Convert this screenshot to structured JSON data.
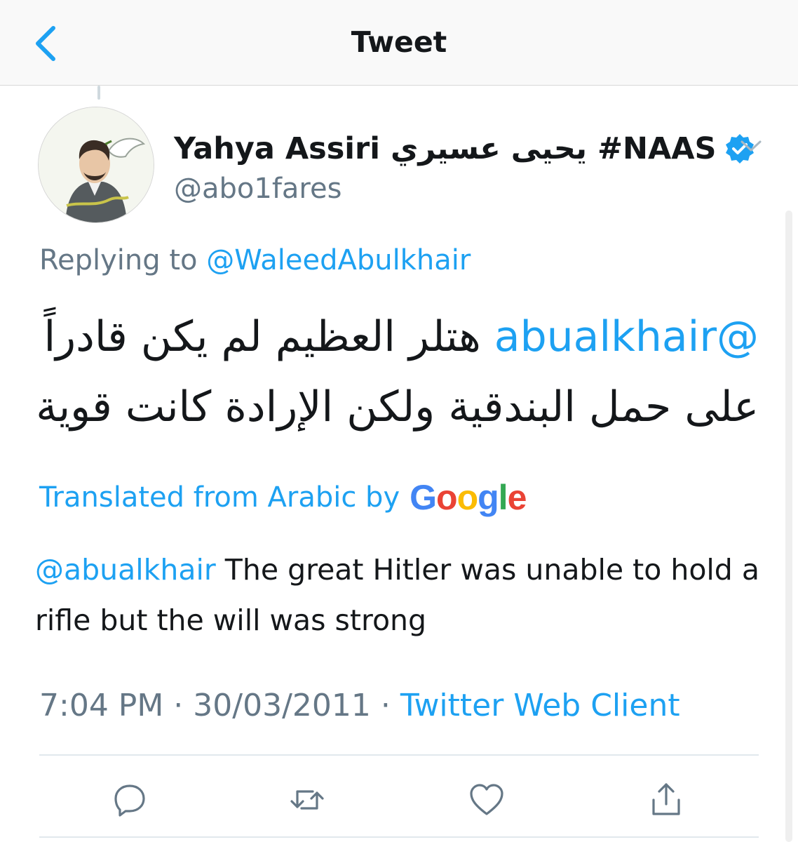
{
  "header": {
    "title": "Tweet",
    "back_icon": "chevron-left-icon"
  },
  "tweet": {
    "author_name": "Yahya Assiri يحيى عسيري #NAAS",
    "handle": "@abo1fares",
    "verified": true,
    "reply_prefix": "Replying to",
    "reply_to": "@WaleedAbulkhair",
    "text_mention": "@abualkhair",
    "text_arabic": "هتلر العظيم لم يكن قادراً على حمل البندقية ولكن الإرادة كانت قوية",
    "translated_label": "Translated from Arabic by",
    "google_letters": [
      "G",
      "o",
      "o",
      "g",
      "l",
      "e"
    ],
    "translation_mention": "@abualkhair",
    "translation_text": " The great Hitler was unable to hold a rifle but the will was strong",
    "time": "7:04 PM",
    "date": "30/03/2011",
    "separator": " · ",
    "client": "Twitter Web Client"
  },
  "actions": [
    {
      "name": "reply-icon"
    },
    {
      "name": "retweet-icon"
    },
    {
      "name": "like-icon"
    },
    {
      "name": "share-icon"
    }
  ],
  "colors": {
    "accent": "#1da1f2",
    "secondary_text": "#657786",
    "google": [
      "#4285F4",
      "#EA4335",
      "#FBBC05",
      "#4285F4",
      "#34A853",
      "#EA4335"
    ]
  }
}
